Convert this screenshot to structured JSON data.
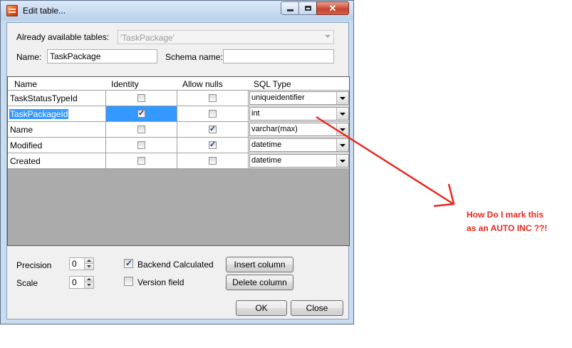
{
  "window": {
    "title": "Edit table..."
  },
  "form": {
    "available_tables_label": "Already available tables:",
    "available_tables_value": "'TaskPackage'",
    "name_label": "Name:",
    "name_value": "TaskPackage",
    "schema_label": "Schema name:",
    "schema_value": ""
  },
  "grid": {
    "columns": [
      "Name",
      "Identity",
      "Allow nulls",
      "SQL Type"
    ],
    "rows": [
      {
        "name": "TaskStatusTypeId",
        "identity": false,
        "allow_nulls": false,
        "sql_type": "uniqueidentifier",
        "selected": false
      },
      {
        "name": "TaskPackageId",
        "identity": true,
        "allow_nulls": false,
        "sql_type": "int",
        "selected": true
      },
      {
        "name": "Name",
        "identity": false,
        "allow_nulls": true,
        "sql_type": "varchar(max)",
        "selected": false
      },
      {
        "name": "Modified",
        "identity": false,
        "allow_nulls": true,
        "sql_type": "datetime",
        "selected": false
      },
      {
        "name": "Created",
        "identity": false,
        "allow_nulls": false,
        "sql_type": "datetime",
        "selected": false
      }
    ]
  },
  "options": {
    "precision_label": "Precision",
    "precision_value": "0",
    "scale_label": "Scale",
    "scale_value": "0",
    "backend_calculated_label": "Backend Calculated",
    "backend_calculated_checked": true,
    "version_field_label": "Version field",
    "version_field_checked": false,
    "insert_column_label": "Insert column",
    "delete_column_label": "Delete column",
    "ok_label": "OK",
    "close_label": "Close"
  },
  "annotation": {
    "line1": "How Do I mark this",
    "line2": "as an AUTO INC ??!",
    "color": "#e8281f"
  },
  "colors": {
    "selection": "#3399ff",
    "grid_background": "#ababab",
    "window_frame": "#c9dcf0"
  }
}
